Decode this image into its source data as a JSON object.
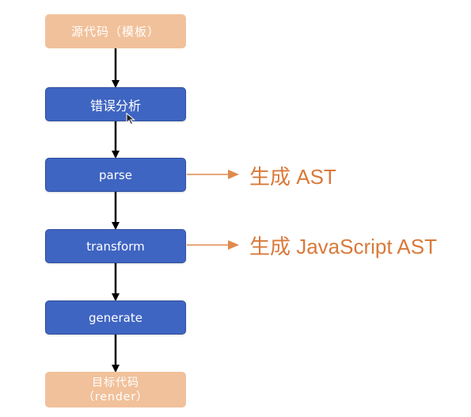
{
  "nodes": {
    "source": "源代码（模板）",
    "error_analysis": "错误分析",
    "parse": "parse",
    "transform": "transform",
    "generate": "generate",
    "target_line1": "目标代码",
    "target_line2": "（render）"
  },
  "annotations": {
    "parse_output": "生成 AST",
    "transform_output": "生成 JavaScript AST"
  },
  "colors": {
    "input_output_node": "#f1c19b",
    "stage_node": "#3f65c2",
    "annotation_text": "#d9793a",
    "annotation_arrow": "#e08a4e",
    "flow_arrow": "#000000"
  },
  "icons": {
    "cursor": "mouse-pointer-icon"
  }
}
